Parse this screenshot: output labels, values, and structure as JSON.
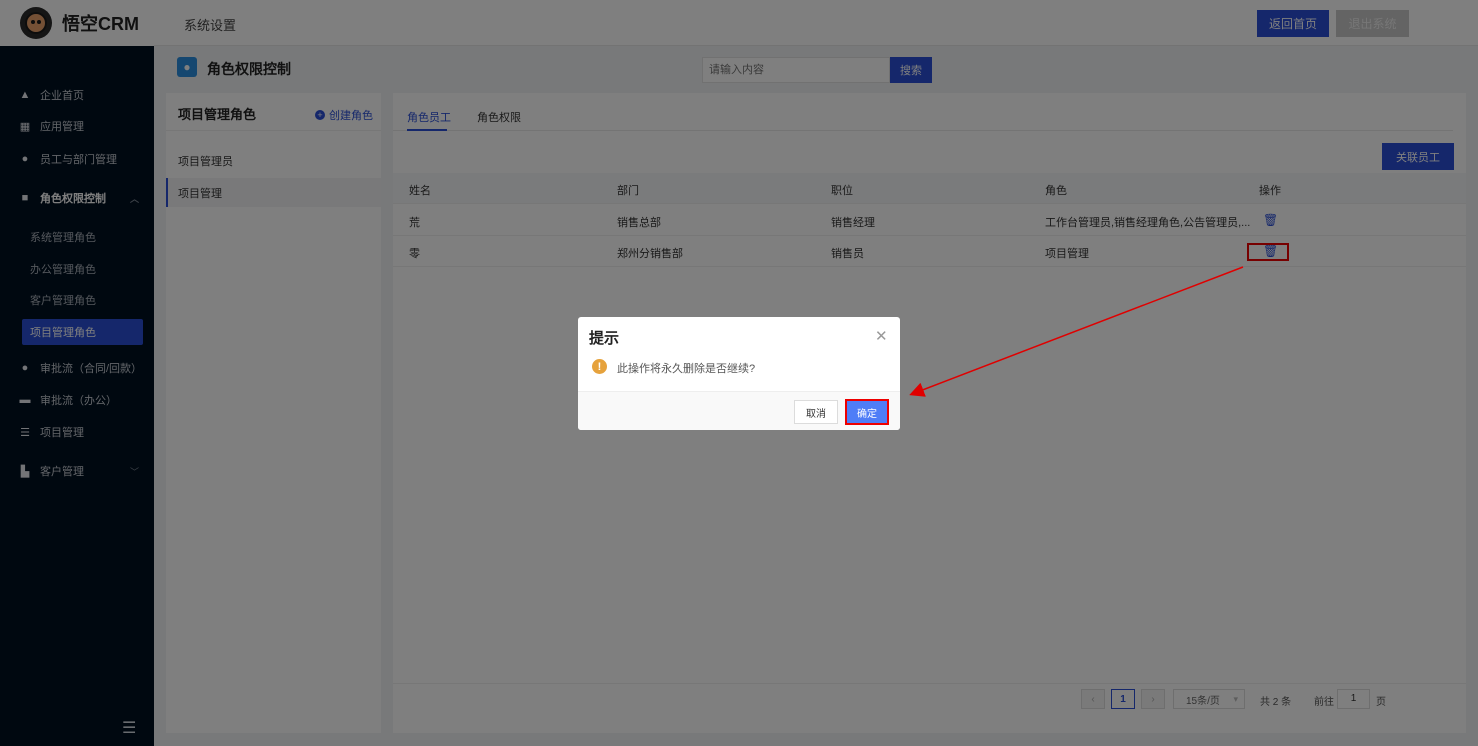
{
  "header": {
    "logo_text": "悟空CRM",
    "section_title": "系统设置",
    "home_button": "返回首页",
    "exit_button": "退出系统"
  },
  "sidebar": {
    "items": [
      {
        "label": "企业首页",
        "icon": "home-icon"
      },
      {
        "label": "应用管理",
        "icon": "grid-icon"
      },
      {
        "label": "员工与部门管理",
        "icon": "users-icon"
      },
      {
        "label": "角色权限控制",
        "icon": "role-icon"
      },
      {
        "label": "审批流（合同/回款）",
        "icon": "user-icon"
      },
      {
        "label": "审批流（办公）",
        "icon": "monitor-icon"
      },
      {
        "label": "项目管理",
        "icon": "project-icon"
      },
      {
        "label": "客户管理",
        "icon": "building-icon"
      }
    ],
    "sub_items": [
      "系统管理角色",
      "办公管理角色",
      "客户管理角色",
      "项目管理角色"
    ],
    "active_sub": "项目管理角色"
  },
  "page": {
    "title": "角色权限控制",
    "search_placeholder": "请输入内容",
    "search_button": "搜索"
  },
  "role_panel": {
    "title": "项目管理角色",
    "create_label": "创建角色",
    "roles": [
      "项目管理员",
      "项目管理"
    ],
    "active_role": "项目管理"
  },
  "content": {
    "tabs": [
      "角色员工",
      "角色权限"
    ],
    "active_tab": "角色员工",
    "link_button": "关联员工",
    "columns": [
      "姓名",
      "部门",
      "职位",
      "角色",
      "操作"
    ],
    "rows": [
      {
        "name": "荒",
        "dept": "销售总部",
        "position": "销售经理",
        "role": "工作台管理员,销售经理角色,公告管理员,..."
      },
      {
        "name": "零",
        "dept": "郑州分销售部",
        "position": "销售员",
        "role": "项目管理"
      }
    ],
    "pagination": {
      "current_page": "1",
      "page_size": "15条/页",
      "total": "共 2 条",
      "goto_label": "前往",
      "goto_value": "1",
      "page_suffix": "页"
    }
  },
  "dialog": {
    "title": "提示",
    "message": "此操作将永久删除是否继续?",
    "cancel": "取消",
    "confirm": "确定"
  },
  "colors": {
    "primary": "#2b4fd6",
    "sidebar_bg": "#001021",
    "warning": "#e6a23c",
    "annotation": "#e00000"
  }
}
